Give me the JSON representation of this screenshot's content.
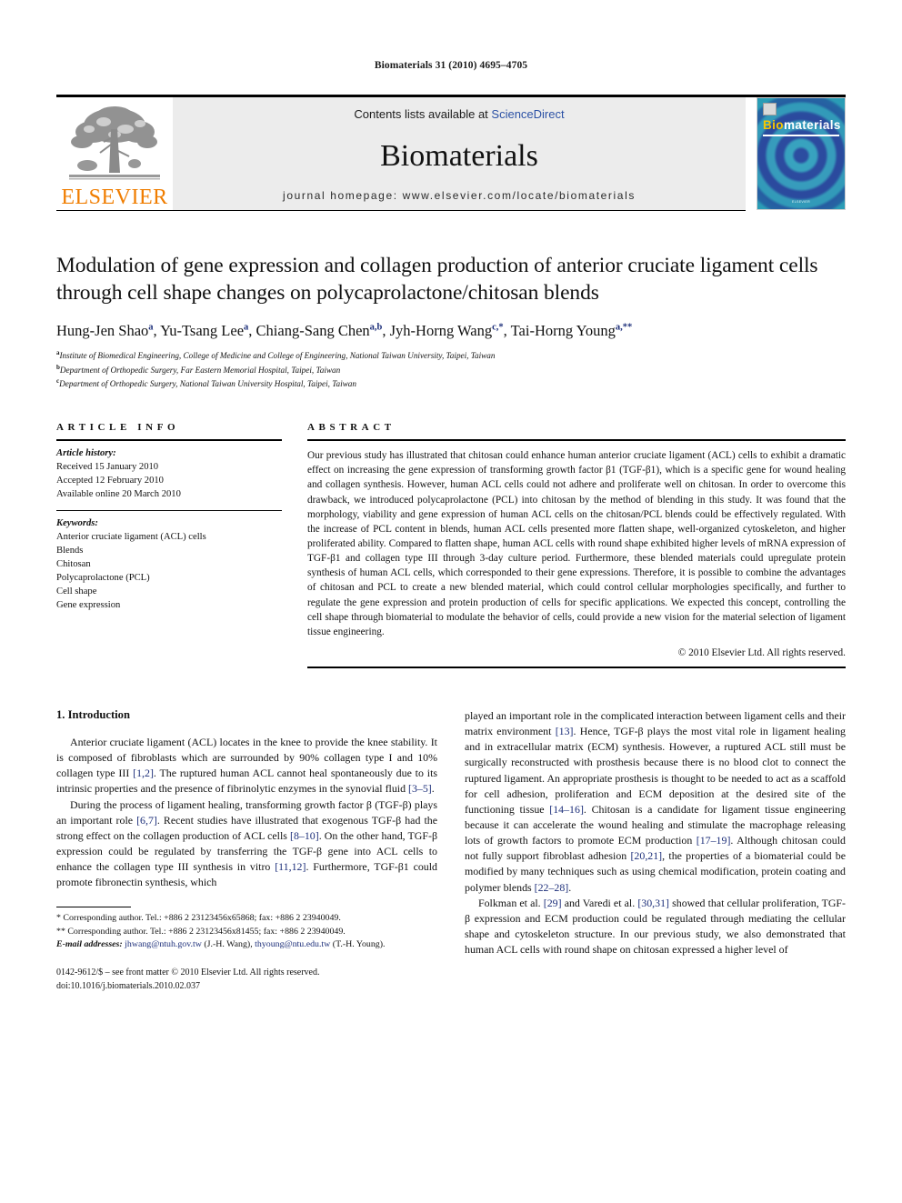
{
  "running_head": "Biomaterials 31 (2010) 4695–4705",
  "masthead": {
    "contents_prefix": "Contents lists available at ",
    "sciencedirect": "ScienceDirect",
    "journal_name": "Biomaterials",
    "homepage": "journal homepage: www.elsevier.com/locate/biomaterials",
    "publisher": "ELSEVIER",
    "cover": {
      "title_bio": "Bio",
      "title_materials": "materials",
      "footer": "ELSEVIER"
    }
  },
  "article": {
    "title": "Modulation of gene expression and collagen production of anterior cruciate ligament cells through cell shape changes on polycaprolactone/chitosan blends",
    "authors": [
      {
        "name": "Hung-Jen Shao",
        "sup": "a"
      },
      {
        "name": "Yu-Tsang Lee",
        "sup": "a"
      },
      {
        "name": "Chiang-Sang Chen",
        "sup": "a,b"
      },
      {
        "name": "Jyh-Horng Wang",
        "sup": "c,*"
      },
      {
        "name": "Tai-Horng Young",
        "sup": "a,**"
      }
    ],
    "affiliations": [
      {
        "mark": "a",
        "text": "Institute of Biomedical Engineering, College of Medicine and College of Engineering, National Taiwan University, Taipei, Taiwan"
      },
      {
        "mark": "b",
        "text": "Department of Orthopedic Surgery, Far Eastern Memorial Hospital, Taipei, Taiwan"
      },
      {
        "mark": "c",
        "text": "Department of Orthopedic Surgery, National Taiwan University Hospital, Taipei, Taiwan"
      }
    ]
  },
  "article_info": {
    "heading": "ARTICLE INFO",
    "history_label": "Article history:",
    "history": [
      "Received 15 January 2010",
      "Accepted 12 February 2010",
      "Available online 20 March 2010"
    ],
    "keywords_label": "Keywords:",
    "keywords": [
      "Anterior cruciate ligament (ACL) cells",
      "Blends",
      "Chitosan",
      "Polycaprolactone (PCL)",
      "Cell shape",
      "Gene expression"
    ]
  },
  "abstract": {
    "heading": "ABSTRACT",
    "text": "Our previous study has illustrated that chitosan could enhance human anterior cruciate ligament (ACL) cells to exhibit a dramatic effect on increasing the gene expression of transforming growth factor β1 (TGF-β1), which is a specific gene for wound healing and collagen synthesis. However, human ACL cells could not adhere and proliferate well on chitosan. In order to overcome this drawback, we introduced polycaprolactone (PCL) into chitosan by the method of blending in this study. It was found that the morphology, viability and gene expression of human ACL cells on the chitosan/PCL blends could be effectively regulated. With the increase of PCL content in blends, human ACL cells presented more flatten shape, well-organized cytoskeleton, and higher proliferated ability. Compared to flatten shape, human ACL cells with round shape exhibited higher levels of mRNA expression of TGF-β1 and collagen type III through 3-day culture period. Furthermore, these blended materials could upregulate protein synthesis of human ACL cells, which corresponded to their gene expressions. Therefore, it is possible to combine the advantages of chitosan and PCL to create a new blended material, which could control cellular morphologies specifically, and further to regulate the gene expression and protein production of cells for specific applications. We expected this concept, controlling the cell shape through biomaterial to modulate the behavior of cells, could provide a new vision for the material selection of ligament tissue engineering.",
    "copyright": "© 2010 Elsevier Ltd. All rights reserved."
  },
  "introduction": {
    "heading": "1. Introduction",
    "left_paragraphs": [
      "Anterior cruciate ligament (ACL) locates in the knee to provide the knee stability. It is composed of fibroblasts which are surrounded by 90% collagen type I and 10% collagen type III [1,2]. The ruptured human ACL cannot heal spontaneously due to its intrinsic properties and the presence of fibrinolytic enzymes in the synovial fluid [3–5].",
      "During the process of ligament healing, transforming growth factor β (TGF-β) plays an important role [6,7]. Recent studies have illustrated that exogenous TGF-β had the strong effect on the collagen production of ACL cells [8–10]. On the other hand, TGF-β expression could be regulated by transferring the TGF-β gene into ACL cells to enhance the collagen type III synthesis in vitro [11,12]. Furthermore, TGF-β1 could promote fibronectin synthesis, which"
    ],
    "right_paragraphs": [
      "played an important role in the complicated interaction between ligament cells and their matrix environment [13]. Hence, TGF-β plays the most vital role in ligament healing and in extracellular matrix (ECM) synthesis. However, a ruptured ACL still must be surgically reconstructed with prosthesis because there is no blood clot to connect the ruptured ligament. An appropriate prosthesis is thought to be needed to act as a scaffold for cell adhesion, proliferation and ECM deposition at the desired site of the functioning tissue [14–16]. Chitosan is a candidate for ligament tissue engineering because it can accelerate the wound healing and stimulate the macrophage releasing lots of growth factors to promote ECM production [17–19]. Although chitosan could not fully support fibroblast adhesion [20,21], the properties of a biomaterial could be modified by many techniques such as using chemical modification, protein coating and polymer blends [22–28].",
      "Folkman et al. [29] and Varedi et al. [30,31] showed that cellular proliferation, TGF-β expression and ECM production could be regulated through mediating the cellular shape and cytoskeleton structure. In our previous study, we also demonstrated that human ACL cells with round shape on chitosan expressed a higher level of"
    ]
  },
  "footnotes": {
    "corresponding_1": "* Corresponding author. Tel.: +886 2 23123456x65868; fax: +886 2 23940049.",
    "corresponding_2": "** Corresponding author. Tel.: +886 2 23123456x81455; fax: +886 2 23940049.",
    "email_label": "E-mail addresses:",
    "email_1": "jhwang@ntuh.gov.tw",
    "email_1_owner": "(J.-H. Wang),",
    "email_2": "thyoung@ntu.edu.tw",
    "email_2_owner": "(T.-H. Young).",
    "imprint_line1": "0142-9612/$ – see front matter © 2010 Elsevier Ltd. All rights reserved.",
    "imprint_line2": "doi:10.1016/j.biomaterials.2010.02.037"
  },
  "colors": {
    "link_blue": "#2b51a5",
    "ref_blue": "#1d2f7a",
    "elsevier_orange": "#F07D00",
    "masthead_grey": "#ececec",
    "cover_teal": "#1b9fb0"
  }
}
